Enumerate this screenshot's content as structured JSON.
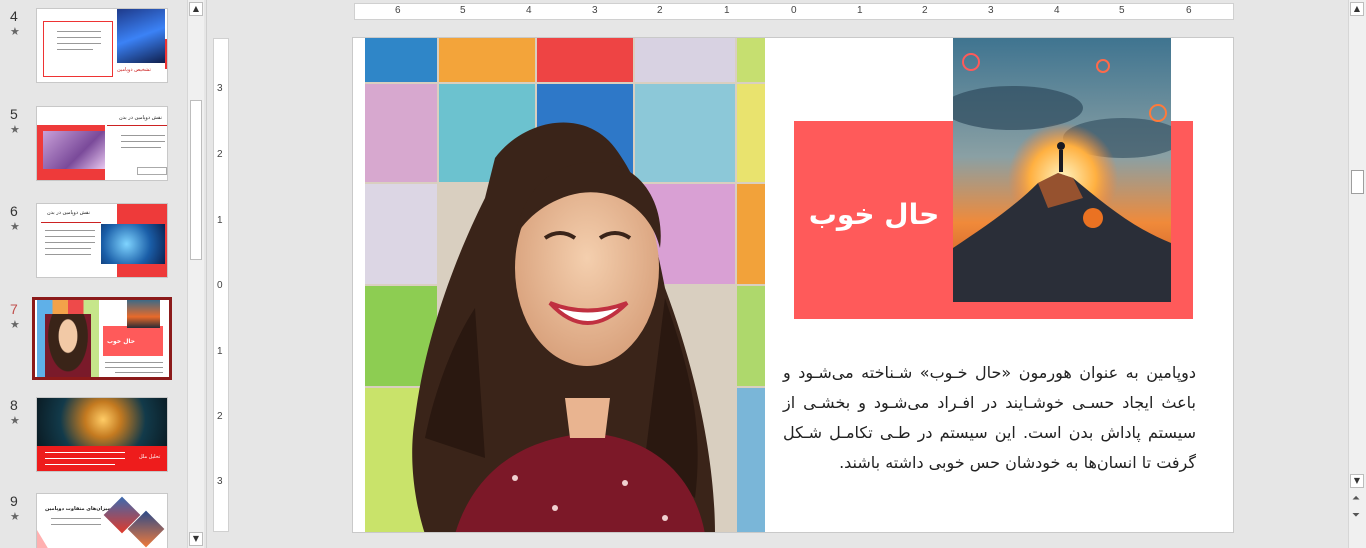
{
  "thumbnails": [
    {
      "number": "4",
      "star": "★",
      "caption": "تشخیص دوپامین"
    },
    {
      "number": "5",
      "star": "★",
      "caption": "نقش دوپامین در بدن"
    },
    {
      "number": "6",
      "star": "★",
      "caption": "نقش دوپامین در بدن"
    },
    {
      "number": "7",
      "star": "★",
      "caption": "حال خوب"
    },
    {
      "number": "8",
      "star": "★",
      "caption": "تحلیل ملل"
    },
    {
      "number": "9",
      "star": "★",
      "caption": "تأثیر میزان‌های متفاوت دوپامین"
    }
  ],
  "active_slide": "7",
  "hruler_labels": [
    "6",
    "5",
    "4",
    "3",
    "2",
    "1",
    "0",
    "1",
    "2",
    "3",
    "4",
    "5",
    "6"
  ],
  "vruler_labels": [
    "3",
    "2",
    "1",
    "0",
    "1",
    "2",
    "3"
  ],
  "slide": {
    "title": "حال خوب",
    "body": "دوپامین به عنوان هورمون «حال خـوب» شـناخته می‌شـود و باعث ایجاد حسـی خوشـایند در افـراد می‌شـود و بخشـی از سیستم پاداش بدن است. این سیستم در طـی تکامـل شـکل گرفت تا انسان‌ها به خودشان حس خوبی داشته باشند."
  },
  "colors": {
    "accent_red": "#ff5a5a",
    "active_border": "#8b1a1a",
    "active_number": "#c0504d"
  },
  "icons": {
    "scroll_up": "▲",
    "scroll_down": "▼",
    "prev_slide": "⏶",
    "next_slide": "⏷"
  }
}
